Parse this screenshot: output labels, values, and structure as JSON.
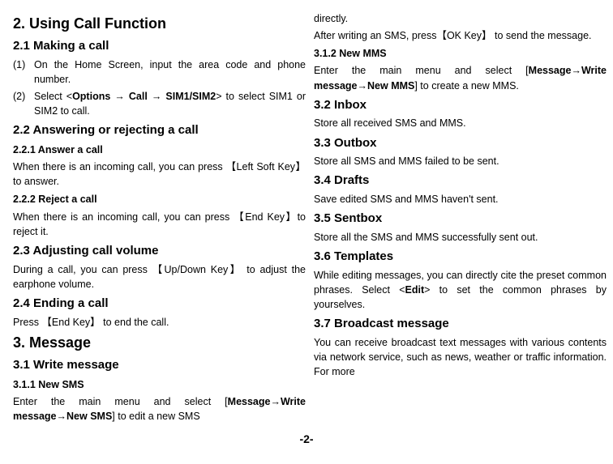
{
  "left": {
    "h1_1": "2. Using Call Function",
    "h2_1": "2.1 Making a call",
    "li1_num": "(1)",
    "li1_txt": "On the Home Screen, input the area code and phone number.",
    "li2_num": "(2)",
    "li2_txt_pre": "Select  <",
    "li2_bold1": "Options",
    "li2_arrow": " → ",
    "li2_bold2": "Call",
    "li2_bold3": "SIM1/SIM2",
    "li2_txt_post": ">  to select SIM1 or SIM2 to call.",
    "h2_2": "2.2 Answering or rejecting a call",
    "h3_1": "2.2.1 Answer a call",
    "p1": "When there is an incoming call, you can press 【Left Soft Key】to answer.",
    "h3_2": "2.2.2 Reject a call",
    "p2": "When there is an incoming call, you can press 【End Key】to reject it.",
    "h2_3": "2.3 Adjusting call volume",
    "p3": "During a call, you can press 【Up/Down Key】 to adjust the earphone volume.",
    "h2_4": "2.4 Ending a call",
    "p4": "Press  【End Key】  to end the call.",
    "h1_2": "3. Message",
    "h2_5": "3.1 Write message",
    "h3_3": "3.1.1 New SMS",
    "p5_pre": "Enter the main menu and select [",
    "p5_bold1": "Message",
    "p5_bold2": "Write message",
    "p5_bold3": "New SMS",
    "p5_post": "] to edit a new SMS"
  },
  "right": {
    "p0": "directly.",
    "p1": "After writing an SMS, press【OK Key】 to send the message.",
    "h3_1": "3.1.2 New MMS",
    "p2_pre": "Enter the main menu and select [",
    "p2_bold1": "Message",
    "p2_bold2": "Write message",
    "p2_bold3": "New MMS",
    "p2_post": "] to create a new MMS.",
    "h2_1": "3.2 Inbox",
    "p3": "Store all received SMS and MMS.",
    "h2_2": "3.3 Outbox",
    "p4": "Store all SMS and MMS failed to be sent.",
    "h2_3": "3.4 Drafts",
    "p5": "Save edited SMS and MMS haven't sent.",
    "h2_4": "3.5 Sentbox",
    "p6": "Store all the SMS and MMS successfully sent out.",
    "h2_5": "3.6 Templates",
    "p7_pre": "While editing messages, you can directly cite the preset common phrases. Select <",
    "p7_bold": "Edit",
    "p7_post": "> to set the common phrases by yourselves.",
    "h2_6": "3.7 Broadcast message",
    "p8": "You can receive broadcast text messages with various contents via network service, such as news, weather or traffic information. For more"
  },
  "footer": "-2-"
}
